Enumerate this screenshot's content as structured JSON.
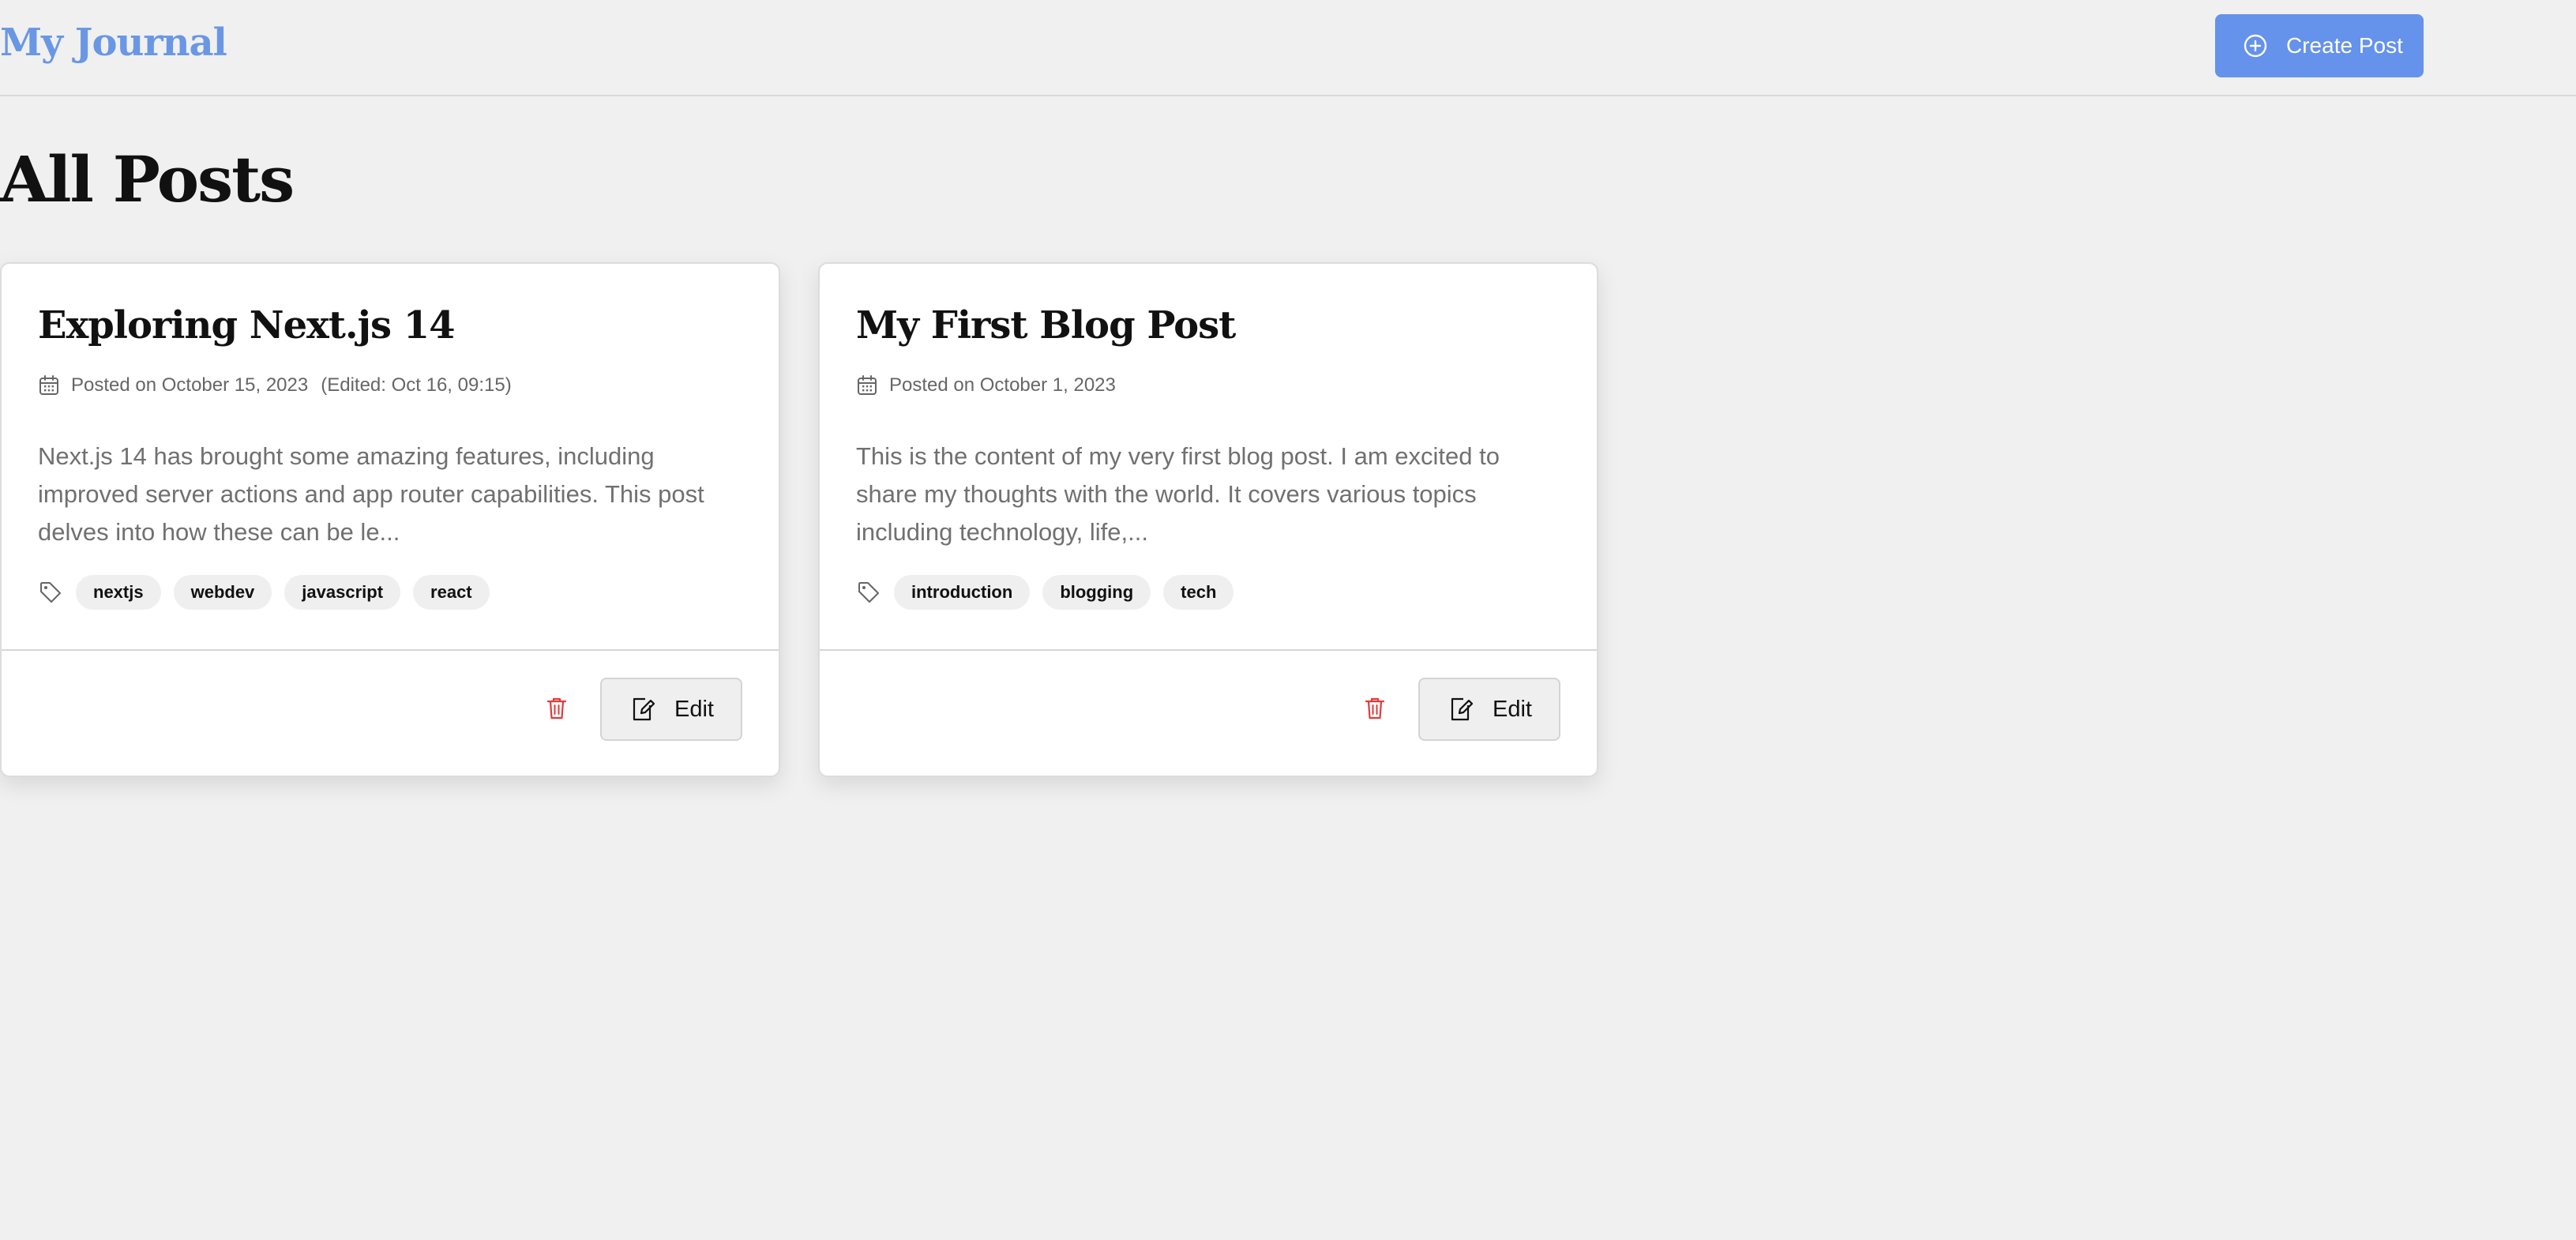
{
  "header": {
    "logo": "My Journal",
    "create_label": "Create Post",
    "accent_color": "#6592ea"
  },
  "main": {
    "title": "All Posts"
  },
  "posts": [
    {
      "title": "Exploring Next.js 14",
      "posted": "Posted on October 15, 2023",
      "edited": "(Edited: Oct 16, 09:15)",
      "excerpt": "Next.js 14 has brought some amazing features, including improved server actions and app router capabilities. This post delves into how these can be le...",
      "tags": [
        "nextjs",
        "webdev",
        "javascript",
        "react"
      ],
      "edit_label": "Edit"
    },
    {
      "title": "My First Blog Post",
      "posted": "Posted on October 1, 2023",
      "excerpt": "This is the content of my very first blog post. I am excited to share my thoughts with the world. It covers various topics including technology, life,...",
      "tags": [
        "introduction",
        "blogging",
        "tech"
      ],
      "edit_label": "Edit"
    }
  ],
  "icons": {
    "create": "plus-circle-icon",
    "date": "calendar-icon",
    "tags": "tag-icon",
    "delete": "trash-icon",
    "edit": "edit-icon"
  },
  "colors": {
    "background": "#f0f0f0",
    "delete": "#e03b3b"
  }
}
